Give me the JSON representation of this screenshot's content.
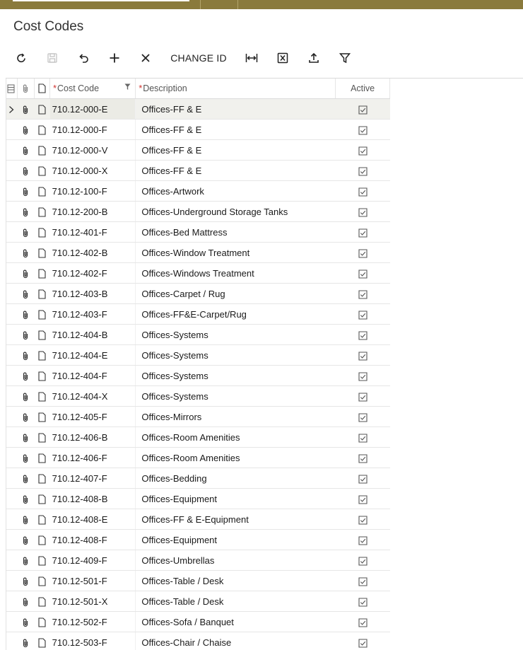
{
  "page": {
    "title": "Cost Codes"
  },
  "toolbar": {
    "refresh_icon": "refresh-icon",
    "save_icon": "save-icon",
    "undo_icon": "undo-icon",
    "add_icon": "plus-icon",
    "delete_icon": "close-icon",
    "change_id_label": "CHANGE ID",
    "fit_icon": "fit-to-screen-icon",
    "export_icon": "excel-icon",
    "upload_icon": "upload-icon",
    "filter_icon": "filter-icon"
  },
  "grid": {
    "columns": {
      "cost_code": "Cost Code",
      "description": "Description",
      "active": "Active",
      "required_mark": "*"
    },
    "rows": [
      {
        "code": "710.12-000-E",
        "desc": "Offices-FF & E",
        "active": true
      },
      {
        "code": "710.12-000-F",
        "desc": "Offices-FF & E",
        "active": true
      },
      {
        "code": "710.12-000-V",
        "desc": "Offices-FF & E",
        "active": true
      },
      {
        "code": "710.12-000-X",
        "desc": "Offices-FF & E",
        "active": true
      },
      {
        "code": "710.12-100-F",
        "desc": "Offices-Artwork",
        "active": true
      },
      {
        "code": "710.12-200-B",
        "desc": "Offices-Underground Storage Tanks",
        "active": true
      },
      {
        "code": "710.12-401-F",
        "desc": "Offices-Bed Mattress",
        "active": true
      },
      {
        "code": "710.12-402-B",
        "desc": "Offices-Window Treatment",
        "active": true
      },
      {
        "code": "710.12-402-F",
        "desc": "Offices-Windows Treatment",
        "active": true
      },
      {
        "code": "710.12-403-B",
        "desc": "Offices-Carpet / Rug",
        "active": true
      },
      {
        "code": "710.12-403-F",
        "desc": "Offices-FF&E-Carpet/Rug",
        "active": true
      },
      {
        "code": "710.12-404-B",
        "desc": "Offices-Systems",
        "active": true
      },
      {
        "code": "710.12-404-E",
        "desc": "Offices-Systems",
        "active": true
      },
      {
        "code": "710.12-404-F",
        "desc": "Offices-Systems",
        "active": true
      },
      {
        "code": "710.12-404-X",
        "desc": "Offices-Systems",
        "active": true
      },
      {
        "code": "710.12-405-F",
        "desc": "Offices-Mirrors",
        "active": true
      },
      {
        "code": "710.12-406-B",
        "desc": "Offices-Room Amenities",
        "active": true
      },
      {
        "code": "710.12-406-F",
        "desc": "Offices-Room Amenities",
        "active": true
      },
      {
        "code": "710.12-407-F",
        "desc": "Offices-Bedding",
        "active": true
      },
      {
        "code": "710.12-408-B",
        "desc": "Offices-Equipment",
        "active": true
      },
      {
        "code": "710.12-408-E",
        "desc": "Offices-FF & E-Equipment",
        "active": true
      },
      {
        "code": "710.12-408-F",
        "desc": "Offices-Equipment",
        "active": true
      },
      {
        "code": "710.12-409-F",
        "desc": "Offices-Umbrellas",
        "active": true
      },
      {
        "code": "710.12-501-F",
        "desc": "Offices-Table / Desk",
        "active": true
      },
      {
        "code": "710.12-501-X",
        "desc": "Offices-Table / Desk",
        "active": true
      },
      {
        "code": "710.12-502-F",
        "desc": "Offices-Sofa / Banquet",
        "active": true
      },
      {
        "code": "710.12-503-F",
        "desc": "Offices-Chair / Chaise",
        "active": true
      }
    ]
  }
}
